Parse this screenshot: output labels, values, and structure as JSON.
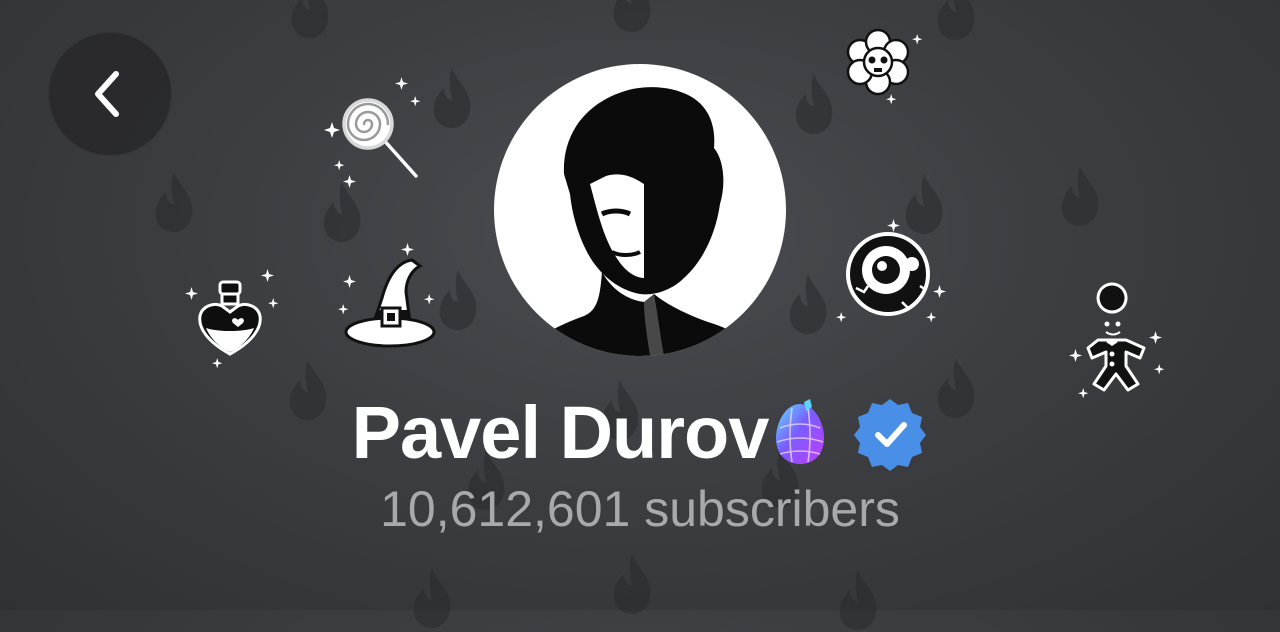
{
  "header": {
    "back_button": {
      "icon": "chevron-left-icon"
    }
  },
  "profile": {
    "name": "Pavel Durov",
    "subscribers": "10,612,601 subscribers",
    "avatar": "avatar",
    "emoji_status": "crystal-ball-egg-icon",
    "verified": true,
    "verified_color": "#4a8fe7"
  },
  "gifts": [
    "lollipop-icon",
    "skull-flower-icon",
    "love-potion-icon",
    "witch-hat-icon",
    "eyeball-icon",
    "gingerbread-man-icon"
  ],
  "background": {
    "pattern_icon": "flame-icon",
    "color": "#3c3e42"
  }
}
